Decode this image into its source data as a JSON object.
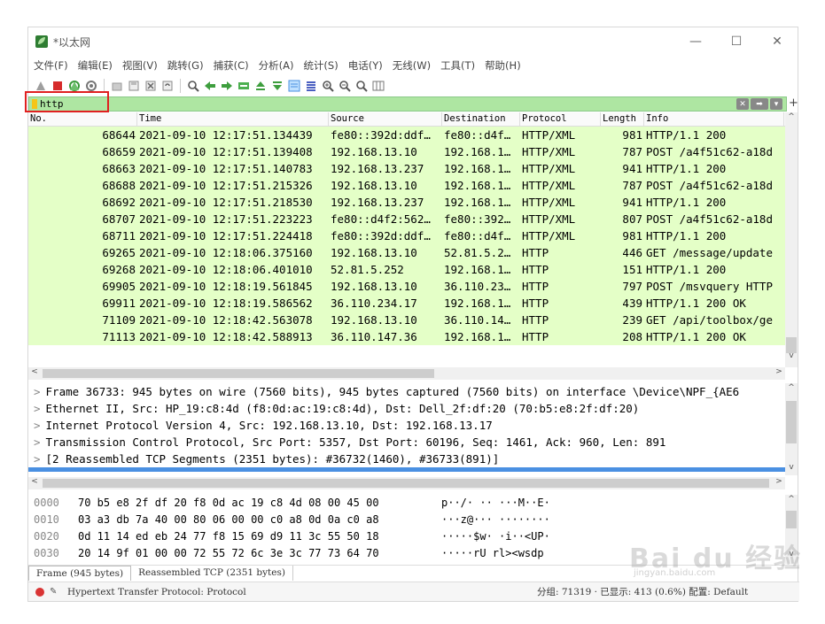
{
  "window": {
    "title": "*以太网",
    "controls": {
      "minimize": "—",
      "maximize": "☐",
      "close": "✕"
    }
  },
  "menu": [
    "文件(F)",
    "编辑(E)",
    "视图(V)",
    "跳转(G)",
    "捕获(C)",
    "分析(A)",
    "统计(S)",
    "电话(Y)",
    "无线(W)",
    "工具(T)",
    "帮助(H)"
  ],
  "filter": {
    "value": "http",
    "plus": "+"
  },
  "columns": [
    "No.",
    "Time",
    "Source",
    "Destination",
    "Protocol",
    "Length",
    "Info"
  ],
  "packets": [
    {
      "no": "68644",
      "time": "2021-09-10 12:17:51.134439",
      "src": "fe80::392d:ddf…",
      "dst": "fe80::d4f…",
      "proto": "HTTP/XML",
      "len": "981",
      "info": "HTTP/1.1 200"
    },
    {
      "no": "68659",
      "time": "2021-09-10 12:17:51.139408",
      "src": "192.168.13.10",
      "dst": "192.168.1…",
      "proto": "HTTP/XML",
      "len": "787",
      "info": "POST /a4f51c62-a18d"
    },
    {
      "no": "68663",
      "time": "2021-09-10 12:17:51.140783",
      "src": "192.168.13.237",
      "dst": "192.168.1…",
      "proto": "HTTP/XML",
      "len": "941",
      "info": "HTTP/1.1 200"
    },
    {
      "no": "68688",
      "time": "2021-09-10 12:17:51.215326",
      "src": "192.168.13.10",
      "dst": "192.168.1…",
      "proto": "HTTP/XML",
      "len": "787",
      "info": "POST /a4f51c62-a18d"
    },
    {
      "no": "68692",
      "time": "2021-09-10 12:17:51.218530",
      "src": "192.168.13.237",
      "dst": "192.168.1…",
      "proto": "HTTP/XML",
      "len": "941",
      "info": "HTTP/1.1 200"
    },
    {
      "no": "68707",
      "time": "2021-09-10 12:17:51.223223",
      "src": "fe80::d4f2:562…",
      "dst": "fe80::392…",
      "proto": "HTTP/XML",
      "len": "807",
      "info": "POST /a4f51c62-a18d"
    },
    {
      "no": "68711",
      "time": "2021-09-10 12:17:51.224418",
      "src": "fe80::392d:ddf…",
      "dst": "fe80::d4f…",
      "proto": "HTTP/XML",
      "len": "981",
      "info": "HTTP/1.1 200"
    },
    {
      "no": "69265",
      "time": "2021-09-10 12:18:06.375160",
      "src": "192.168.13.10",
      "dst": "52.81.5.2…",
      "proto": "HTTP",
      "len": "446",
      "info": "GET /message/update"
    },
    {
      "no": "69268",
      "time": "2021-09-10 12:18:06.401010",
      "src": "52.81.5.252",
      "dst": "192.168.1…",
      "proto": "HTTP",
      "len": "151",
      "info": "HTTP/1.1 200"
    },
    {
      "no": "69905",
      "time": "2021-09-10 12:18:19.561845",
      "src": "192.168.13.10",
      "dst": "36.110.23…",
      "proto": "HTTP",
      "len": "797",
      "info": "POST /msvquery HTTP"
    },
    {
      "no": "69911",
      "time": "2021-09-10 12:18:19.586562",
      "src": "36.110.234.17",
      "dst": "192.168.1…",
      "proto": "HTTP",
      "len": "439",
      "info": "HTTP/1.1 200 OK"
    },
    {
      "no": "71109",
      "time": "2021-09-10 12:18:42.563078",
      "src": "192.168.13.10",
      "dst": "36.110.14…",
      "proto": "HTTP",
      "len": "239",
      "info": "GET /api/toolbox/ge"
    },
    {
      "no": "71113",
      "time": "2021-09-10 12:18:42.588913",
      "src": "36.110.147.36",
      "dst": "192.168.1…",
      "proto": "HTTP",
      "len": "208",
      "info": "HTTP/1.1 200 OK"
    }
  ],
  "details": [
    "Frame 36733: 945 bytes on wire (7560 bits), 945 bytes captured (7560 bits) on interface \\Device\\NPF_{AE6",
    "Ethernet II, Src: HP_19:c8:4d (f8:0d:ac:19:c8:4d), Dst: Dell_2f:df:20 (70:b5:e8:2f:df:20)",
    "Internet Protocol Version 4, Src: 192.168.13.10, Dst: 192.168.13.17",
    "Transmission Control Protocol, Src Port: 5357, Dst Port: 60196, Seq: 1461, Ack: 960, Len: 891",
    "[2 Reassembled TCP Segments (2351 bytes): #36732(1460), #36733(891)]"
  ],
  "hex": [
    {
      "off": "0000",
      "bytes": "70 b5 e8 2f df 20 f8 0d  ac 19 c8 4d 08 00 45 00",
      "ascii": "p··/· ·· ···M··E·"
    },
    {
      "off": "0010",
      "bytes": "03 a3 db 7a 40 00 80 06  00 00 c0 a8 0d 0a c0 a8",
      "ascii": "···z@··· ········"
    },
    {
      "off": "0020",
      "bytes": "0d 11 14 ed eb 24 77 f8  15 69 d9 11 3c 55 50 18",
      "ascii": "·····$w· ·i··<UP·"
    },
    {
      "off": "0030",
      "bytes": "20 14 9f 01 00 00 72 55  72 6c 3e 3c 77 73 64 70",
      "ascii": " ·····rU rl><wsdp"
    }
  ],
  "byte_tabs": [
    "Frame (945 bytes)",
    "Reassembled TCP (2351 bytes)"
  ],
  "status": {
    "text": "Hypertext Transfer Protocol: Protocol",
    "right": "分组: 71319 · 已显示: 413 (0.6%)  配置: Default"
  },
  "watermark": {
    "main": "Bai du 经验",
    "sub": "jingyan.baidu.com"
  },
  "colors": {
    "http_row": "#e4ffc7",
    "filter_ok": "#aee6a2",
    "selection": "#4a90e2",
    "highlight_box": "#e02020"
  }
}
